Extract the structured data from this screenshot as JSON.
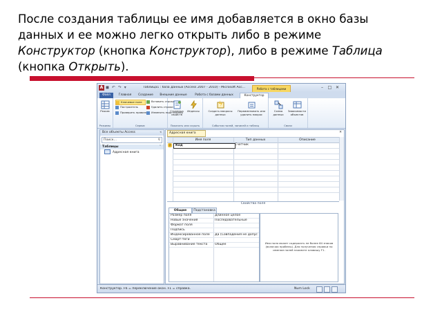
{
  "caption": {
    "line1": "После создания таблицы ее имя добавляется в окно базы",
    "line2": "данных и ее можно легко открыть либо в режиме",
    "line3_italic_a": "Конструктор",
    "line3_text_a": " (кнопка ",
    "line3_italic_b": "Конструктор",
    "line3_text_b": "), либо в режиме ",
    "line3_italic_c": "Таблица",
    "line4_text_a": "(кнопка ",
    "line4_italic": "Открыть",
    "line4_text_b": ")."
  },
  "window": {
    "app_icon": "A",
    "qat": "◼ ↶ ↷ ▾",
    "title": "Таблица1 : база данных (Access 2007 - 2010) - Microsoft Acc...",
    "context_tab": "Работа с таблицами",
    "controls": [
      "–",
      "□",
      "✕"
    ]
  },
  "tabs": [
    "Файл",
    "Главная",
    "Создание",
    "Внешние данные",
    "Работа с базами данных",
    "Конструктор"
  ],
  "ribbon": {
    "groups": [
      {
        "label": "Режимы",
        "buttons": [
          "Режим"
        ]
      },
      {
        "label": "Сервис",
        "small": [
          "Ключевое поле",
          "Построитель",
          "Проверить правила",
          "Вставить строки",
          "Удалить строки",
          "Изменить подстановку"
        ]
      },
      {
        "label": "Показать или скрыть",
        "buttons": [
          "Страница свойств",
          "Индексы"
        ]
      },
      {
        "label": "События полей, записей и таблиц",
        "buttons": [
          "Создать макросы данных",
          "Переименовать или удалить макрос"
        ]
      },
      {
        "label": "Связи",
        "buttons": [
          "Схема данных",
          "Зависимости объектов"
        ]
      }
    ]
  },
  "nav": {
    "header": "Все объекты Access",
    "search_placeholder": "Поиск...",
    "group": "Таблицы",
    "items": [
      "Адресная книга"
    ]
  },
  "document": {
    "tab": "Адресная книга",
    "columns": [
      "Имя поля",
      "Тип данных",
      "Описание"
    ],
    "field_name": "Код",
    "field_type": "Счетчик",
    "properties_caption": "Свойства поля"
  },
  "properties": {
    "tabs": [
      "Общие",
      "Подстановка"
    ],
    "rows": [
      {
        "k": "Размер поля",
        "v": "Длинное целое"
      },
      {
        "k": "Новые значения",
        "v": "Последовательные"
      },
      {
        "k": "Формат поля",
        "v": ""
      },
      {
        "k": "Подпись",
        "v": ""
      },
      {
        "k": "Индексированное поле",
        "v": "Да (Совпадения не допускаются)"
      },
      {
        "k": "Смарт-теги",
        "v": ""
      },
      {
        "k": "Выравнивание текста",
        "v": "Общее"
      }
    ],
    "hint": "Имя поля может содержать не более 64 знаков (включая пробелы). Для получения справки по именам полей нажмите клавишу F1."
  },
  "status": {
    "text": "Конструктор. F6 = переключение окон. F1 = справка.",
    "lock": "Num Lock"
  }
}
